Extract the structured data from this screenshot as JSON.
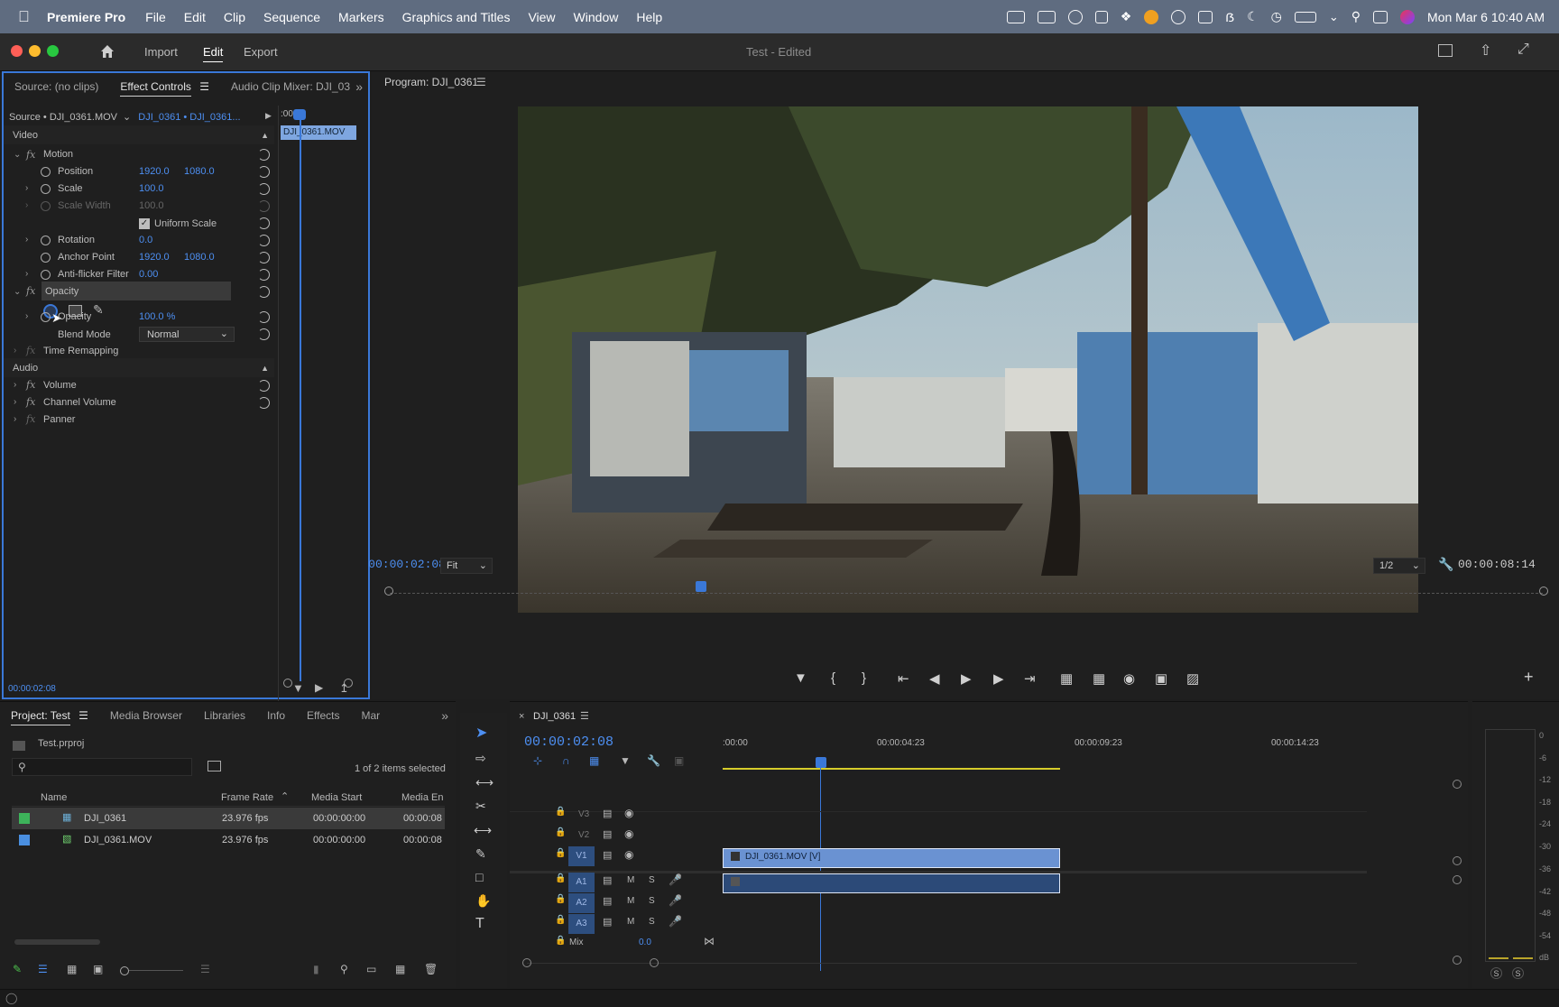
{
  "menubar": {
    "app_name": "Premiere Pro",
    "items": [
      "File",
      "Edit",
      "Clip",
      "Sequence",
      "Markers",
      "Graphics and Titles",
      "View",
      "Window",
      "Help"
    ],
    "datetime": "Mon Mar 6  10:40 AM"
  },
  "titlebar": {
    "nav": [
      "Import",
      "Edit",
      "Export"
    ],
    "active_nav": "Edit",
    "doc_title": "Test - Edited"
  },
  "effect_controls": {
    "tabs": [
      "Source: (no clips)",
      "Effect Controls",
      "Audio Clip Mixer: DJI_03"
    ],
    "active_tab": "Effect Controls",
    "source_label": "Source • DJI_0361.MOV",
    "sequence_label": "DJI_0361 • DJI_0361...",
    "ruler_time": ":00:0",
    "clip_name": "DJI_0361.MOV",
    "sections": {
      "video": "Video",
      "audio": "Audio"
    },
    "effects": {
      "motion": "Motion",
      "position_label": "Position",
      "position_x": "1920.0",
      "position_y": "1080.0",
      "scale_label": "Scale",
      "scale_value": "100.0",
      "scale_width_label": "Scale Width",
      "scale_width_value": "100.0",
      "uniform_scale": "Uniform Scale",
      "rotation_label": "Rotation",
      "rotation_value": "0.0",
      "anchor_label": "Anchor Point",
      "anchor_x": "1920.0",
      "anchor_y": "1080.0",
      "antiflicker_label": "Anti-flicker Filter",
      "antiflicker_value": "0.00",
      "opacity": "Opacity",
      "opacity_label": "Opacity",
      "opacity_value": "100.0 %",
      "blend_label": "Blend Mode",
      "blend_value": "Normal",
      "time_remap": "Time Remapping",
      "volume": "Volume",
      "channel_volume": "Channel Volume",
      "panner": "Panner"
    },
    "timecode": "00:00:02:08"
  },
  "program": {
    "title": "Program: DJI_0361",
    "timecode": "00:00:02:08",
    "fit": "Fit",
    "resolution": "1/2",
    "duration": "00:00:08:14",
    "playhead_fraction": 0.27
  },
  "project": {
    "tabs": [
      "Project: Test",
      "Media Browser",
      "Libraries",
      "Info",
      "Effects",
      "Mar"
    ],
    "active_tab": "Project: Test",
    "file": "Test.prproj",
    "selection": "1 of 2 items selected",
    "columns": [
      "Name",
      "Frame Rate",
      "Media Start",
      "Media En"
    ],
    "rows": [
      {
        "name": "DJI_0361",
        "fps": "23.976 fps",
        "start": "00:00:00:00",
        "end": "00:00:08",
        "color": "#3db35a"
      },
      {
        "name": "DJI_0361.MOV",
        "fps": "23.976 fps",
        "start": "00:00:00:00",
        "end": "00:00:08",
        "color": "#4a8fe0"
      }
    ]
  },
  "timeline": {
    "tab": "DJI_0361",
    "timecode": "00:00:02:08",
    "ruler": [
      ":00:00",
      "00:00:04:23",
      "00:00:09:23",
      "00:00:14:23"
    ],
    "video_tracks": [
      "V3",
      "V2",
      "V1"
    ],
    "audio_tracks": [
      "A1",
      "A2",
      "A3"
    ],
    "mix_label": "Mix",
    "mix_value": "0.0",
    "clip_label": "DJI_0361.MOV [V]",
    "mute": "M",
    "solo": "S"
  },
  "meter": {
    "scale": [
      "0",
      "-6",
      "-12",
      "-18",
      "-24",
      "-30",
      "-36",
      "-42",
      "-48",
      "-54",
      "dB"
    ],
    "solo": [
      "S",
      "S"
    ]
  }
}
